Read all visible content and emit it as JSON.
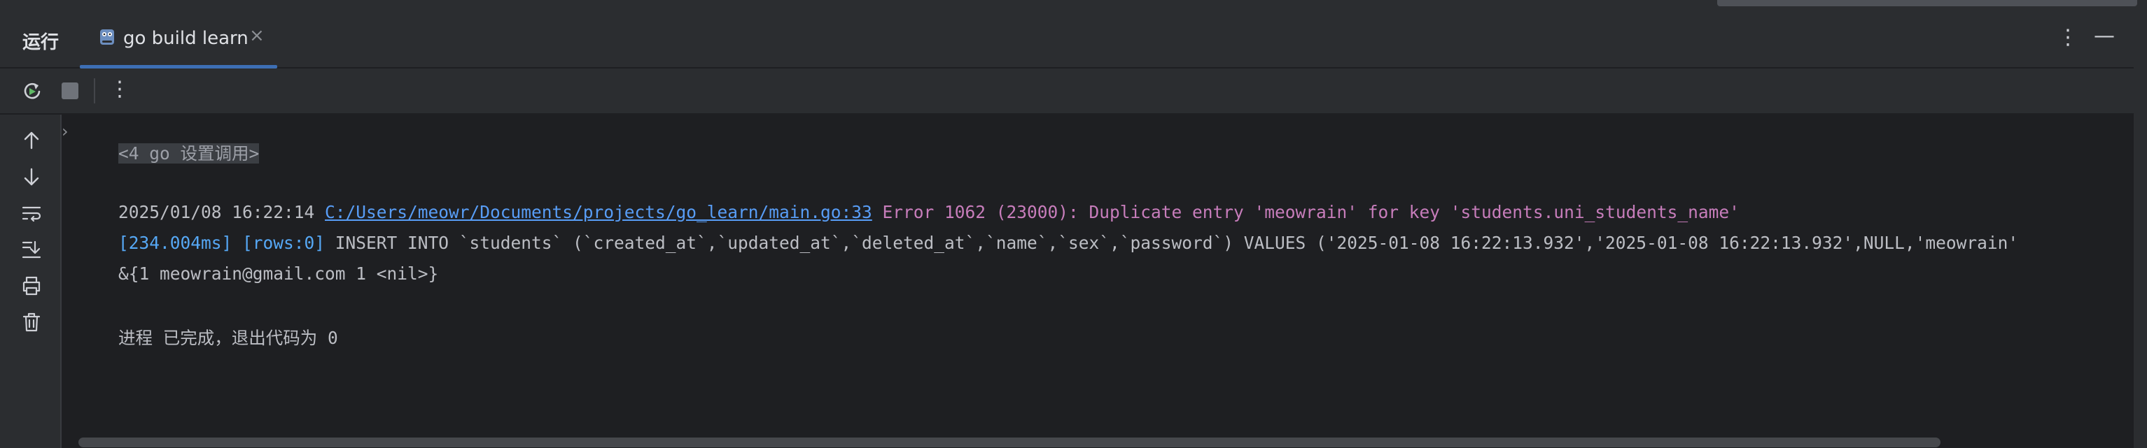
{
  "header": {
    "panel_title": "运行",
    "tab_label": "go build learn",
    "tab_close": "×",
    "options_glyph": "⋮",
    "minimize_glyph": "—"
  },
  "toolbar": {
    "rerun_icon": "rerun-icon",
    "stop_icon": "stop-icon",
    "more_glyph": "⋮"
  },
  "sidebar": {
    "icons": [
      "arrow-up-icon",
      "arrow-down-icon",
      "soft-wrap-icon",
      "scroll-to-end-icon",
      "print-icon",
      "trash-icon"
    ]
  },
  "console": {
    "folded_arrow": "›",
    "folded_text": "<4 go 设置调用>",
    "line1_time": "2025/01/08 16:22:14 ",
    "line1_link": "C:/Users/meowr/Documents/projects/go_learn/main.go:33",
    "line1_error": " Error 1062 (23000): Duplicate entry 'meowrain' for key 'students.uni_students_name'",
    "line2_meta": "[234.004ms] [rows:0]",
    "line2_sql": " INSERT INTO `students` (`created_at`,`updated_at`,`deleted_at`,`name`,`sex`,`password`) VALUES ('2025-01-08 16:22:13.932','2025-01-08 16:22:13.932',NULL,'meowrain'",
    "line3": "&{1 meowrain@gmail.com 1 <nil>}",
    "line4": "进程 已完成，退出代码为 0"
  },
  "colors": {
    "background": "#1e1f22",
    "panel": "#2b2d30",
    "link": "#589df6",
    "error": "#c77dbb",
    "sql_meta": "#56a8f5",
    "accent_underline": "#3d6fb4"
  }
}
